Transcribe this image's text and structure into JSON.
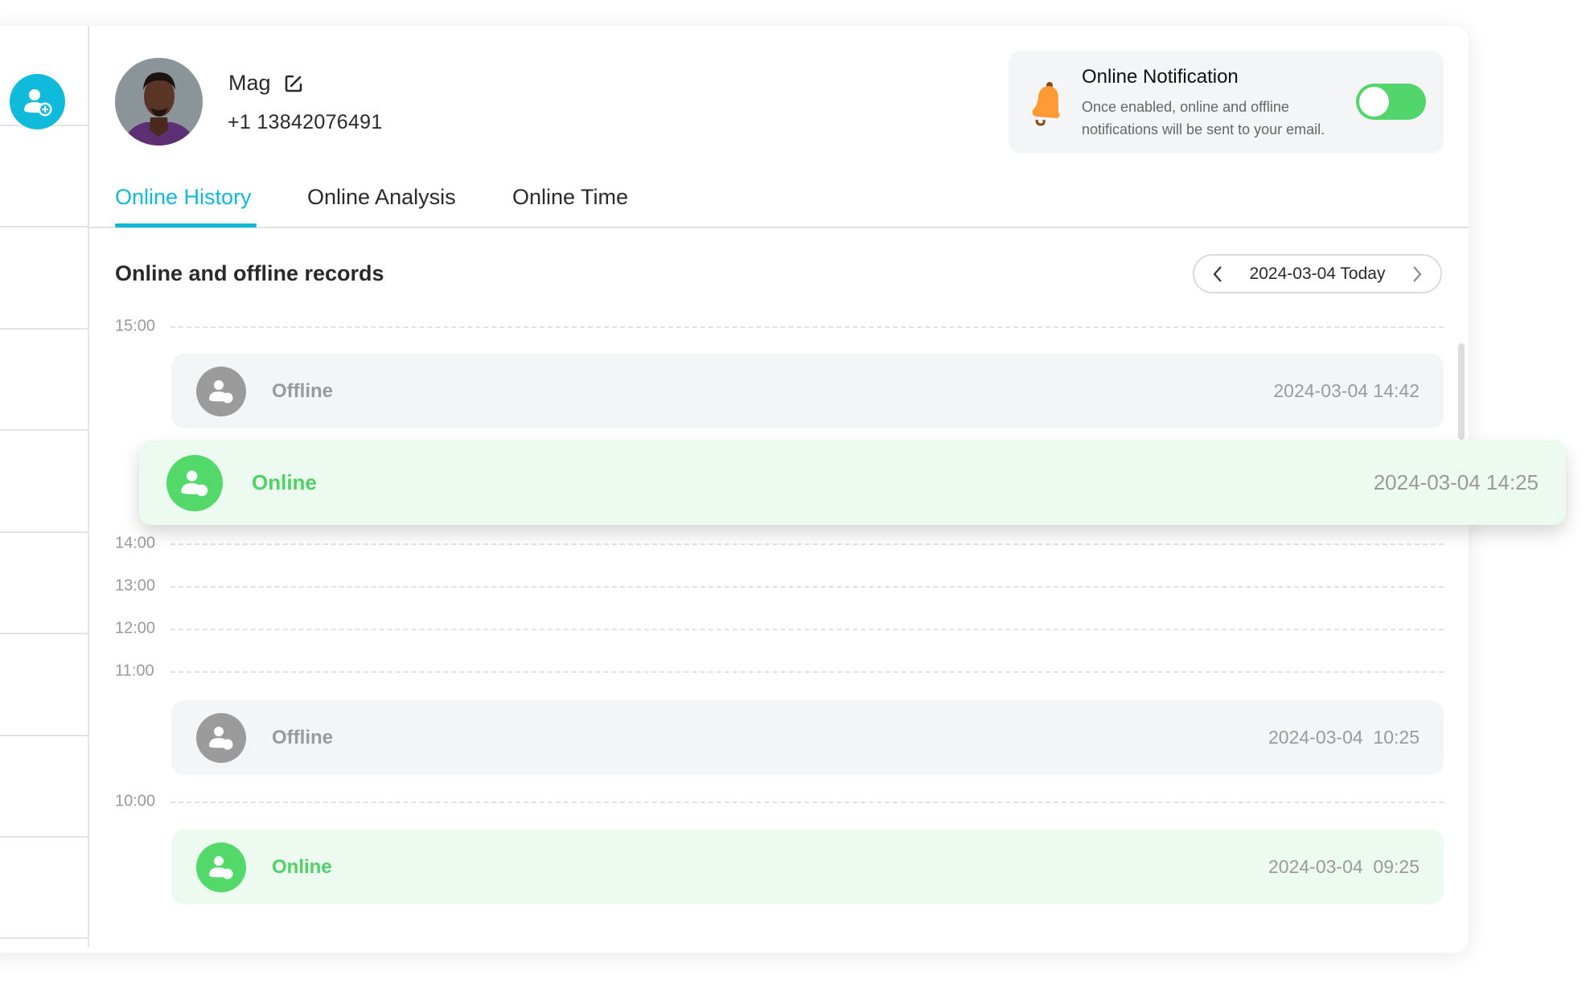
{
  "profile": {
    "name": "Mag",
    "phone": "+1 13842076491"
  },
  "notification": {
    "title": "Online Notification",
    "description": "Once enabled, online and offline notifications will be sent to your email.",
    "enabled": true
  },
  "tabs": [
    {
      "label": "Online History",
      "active": true
    },
    {
      "label": "Online Analysis",
      "active": false
    },
    {
      "label": "Online Time",
      "active": false
    }
  ],
  "records_section": {
    "title": "Online and offline records",
    "date_label": "2024-03-04 Today"
  },
  "timeline": {
    "ticks": [
      "15:00",
      "14:00",
      "13:00",
      "12:00",
      "11:00",
      "10:00"
    ],
    "records": [
      {
        "status": "Offline",
        "time": "2024-03-04 14:42"
      },
      {
        "status": "Online",
        "time": "2024-03-04 14:25"
      },
      {
        "status": "Offline",
        "time": "2024-03-04  10:25"
      },
      {
        "status": "Online",
        "time": "2024-03-04  09:25"
      }
    ]
  },
  "colors": {
    "accent": "#10b8d8",
    "online": "#53d86a",
    "offline": "#9b9b9b",
    "bell": "#ff9a35"
  }
}
